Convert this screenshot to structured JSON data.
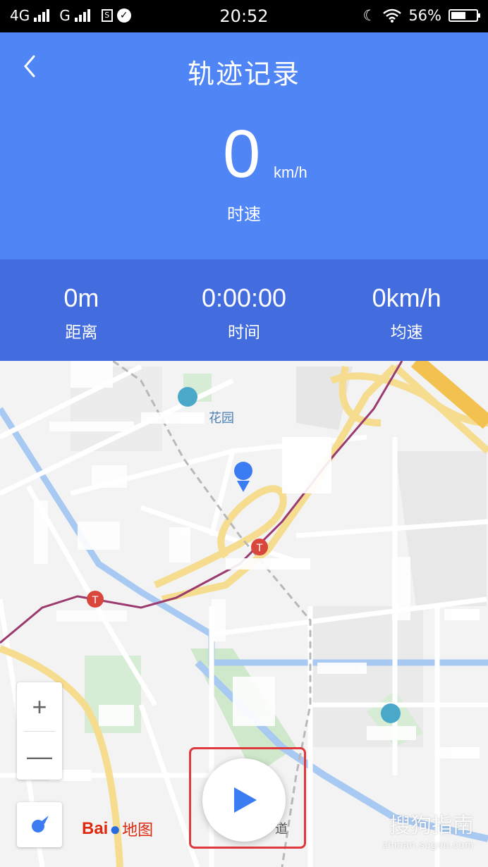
{
  "status_bar": {
    "network1": "4G",
    "network2": "G",
    "time": "20:52",
    "battery": "56%"
  },
  "header": {
    "title": "轨迹记录",
    "speed_value": "0",
    "speed_unit": "km/h",
    "speed_label": "时速"
  },
  "stats": [
    {
      "value": "0m",
      "label": "距离"
    },
    {
      "value": "0:00:00",
      "label": "时间"
    },
    {
      "value": "0km/h",
      "label": "均速"
    }
  ],
  "map": {
    "poi_label_1": "花园",
    "poi_label_2": "道",
    "logo_text": "Bai",
    "logo_suffix": "地图",
    "zoom_in": "+",
    "zoom_out": "—"
  },
  "watermark": {
    "title": "搜狗指南",
    "sub": "zhinan.sogou.com"
  },
  "colors": {
    "header_bg": "#5085f5",
    "stats_bg": "#436ddf",
    "accent": "#3b7cf2",
    "route_line": "#9b3a6e",
    "highlight": "#e0393b"
  }
}
